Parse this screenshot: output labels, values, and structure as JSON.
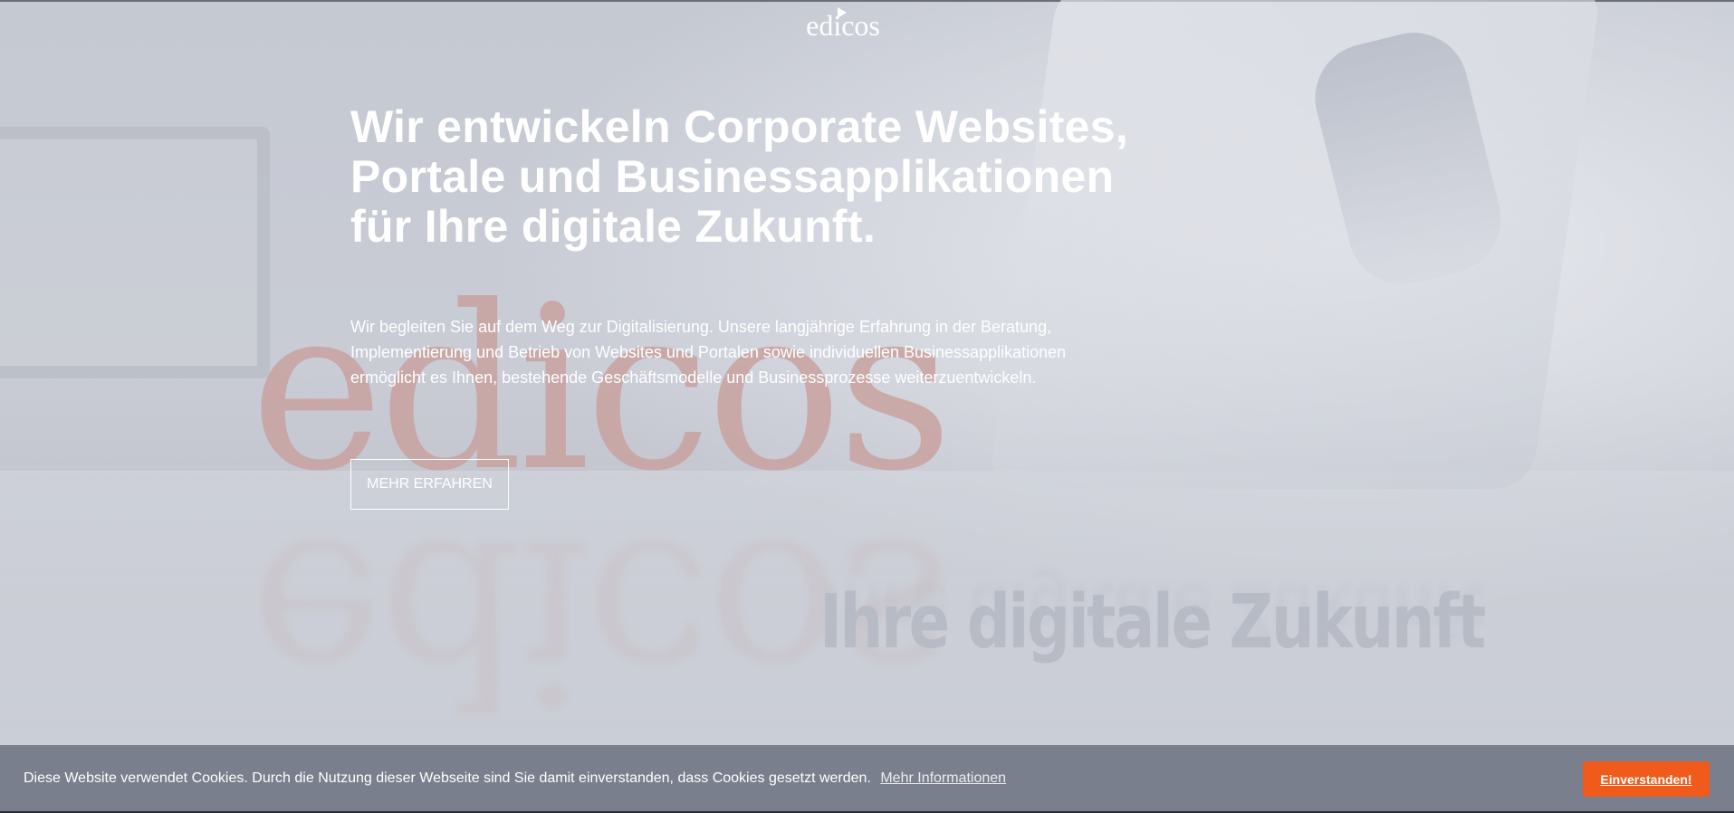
{
  "header": {
    "logo_text": "edicos"
  },
  "background": {
    "wordmark": "edicos",
    "tagline": "Ihre digitale Zukunft"
  },
  "hero": {
    "title": "Wir entwickeln Corporate Websites, Portale und Businessapplikationen für Ihre digitale Zukunft.",
    "text": "Wir begleiten Sie auf dem Weg zur Digitalisierung. Unsere langjährige Erfahrung in der Beratung, Implementierung und Betrieb von Websites und Portalen sowie individuellen Businessapplikationen ermöglicht es Ihnen, bestehende Geschäftsmodelle und Businessprozesse weiterzuentwickeln.",
    "cta_label": "MEHR ERFAHREN"
  },
  "cookie_bar": {
    "message": "Diese Website verwendet Cookies. Durch die Nutzung dieser Webseite sind Sie damit einverstanden, dass Cookies gesetzt werden.",
    "more_info_label": "Mehr Informationen",
    "accept_label": "Einverstanden!",
    "accept_color": "#f05a1a",
    "bar_color": "#7a7f8d"
  }
}
